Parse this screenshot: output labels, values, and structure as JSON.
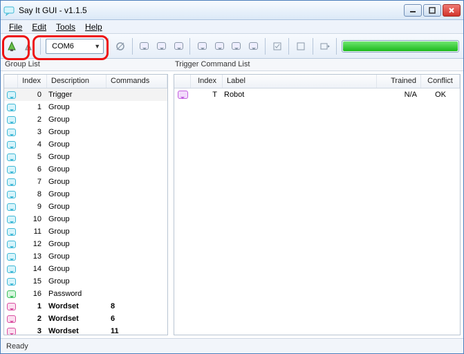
{
  "window": {
    "title": "Say It GUI - v1.1.5"
  },
  "menu": {
    "file": "File",
    "edit": "Edit",
    "tools": "Tools",
    "help": "Help"
  },
  "toolbar": {
    "port_value": "COM6",
    "progress_percent": 100
  },
  "panels": {
    "left_title": "Group List",
    "right_title": "Trigger Command List"
  },
  "group_columns": {
    "index": "Index",
    "description": "Description",
    "commands": "Commands"
  },
  "group_rows": [
    {
      "icon": "cyan",
      "index": "0",
      "description": "Trigger",
      "commands": "",
      "selected": true
    },
    {
      "icon": "cyan",
      "index": "1",
      "description": "Group",
      "commands": ""
    },
    {
      "icon": "cyan",
      "index": "2",
      "description": "Group",
      "commands": ""
    },
    {
      "icon": "cyan",
      "index": "3",
      "description": "Group",
      "commands": ""
    },
    {
      "icon": "cyan",
      "index": "4",
      "description": "Group",
      "commands": ""
    },
    {
      "icon": "cyan",
      "index": "5",
      "description": "Group",
      "commands": ""
    },
    {
      "icon": "cyan",
      "index": "6",
      "description": "Group",
      "commands": ""
    },
    {
      "icon": "cyan",
      "index": "7",
      "description": "Group",
      "commands": ""
    },
    {
      "icon": "cyan",
      "index": "8",
      "description": "Group",
      "commands": ""
    },
    {
      "icon": "cyan",
      "index": "9",
      "description": "Group",
      "commands": ""
    },
    {
      "icon": "cyan",
      "index": "10",
      "description": "Group",
      "commands": ""
    },
    {
      "icon": "cyan",
      "index": "11",
      "description": "Group",
      "commands": ""
    },
    {
      "icon": "cyan",
      "index": "12",
      "description": "Group",
      "commands": ""
    },
    {
      "icon": "cyan",
      "index": "13",
      "description": "Group",
      "commands": ""
    },
    {
      "icon": "cyan",
      "index": "14",
      "description": "Group",
      "commands": ""
    },
    {
      "icon": "cyan",
      "index": "15",
      "description": "Group",
      "commands": ""
    },
    {
      "icon": "green",
      "index": "16",
      "description": "Password",
      "commands": ""
    },
    {
      "icon": "pink",
      "index": "1",
      "description": "Wordset",
      "commands": "8",
      "bold": true
    },
    {
      "icon": "pink",
      "index": "2",
      "description": "Wordset",
      "commands": "6",
      "bold": true
    },
    {
      "icon": "pink",
      "index": "3",
      "description": "Wordset",
      "commands": "11",
      "bold": true
    }
  ],
  "trigger_columns": {
    "index": "Index",
    "label": "Label",
    "trained": "Trained",
    "conflict": "Conflict"
  },
  "trigger_rows": [
    {
      "icon": "purple",
      "index": "T",
      "label": "Robot",
      "trained": "N/A",
      "conflict": "OK"
    }
  ],
  "status": {
    "text": "Ready"
  }
}
